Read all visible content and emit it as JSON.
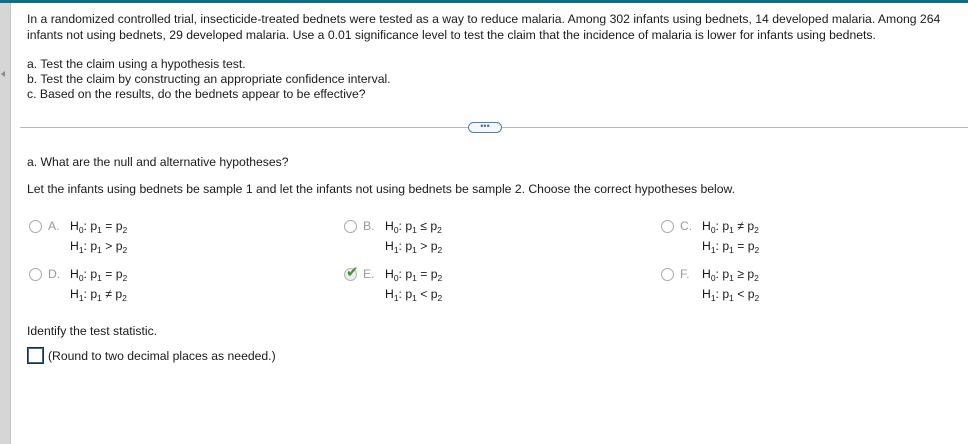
{
  "problem": {
    "text": "In a randomized controlled trial, insecticide-treated bednets were tested as a way to reduce malaria. Among 302 infants using bednets, 14 developed malaria. Among 264 infants not using bednets, 29 developed malaria. Use a 0.01 significance level to test the claim that the incidence of malaria is lower for infants using bednets.",
    "parts": [
      "a. Test the claim using a hypothesis test.",
      "b. Test the claim by constructing an appropriate confidence interval.",
      "c. Based on the results, do the bednets appear to be effective?"
    ]
  },
  "expand_button": "•••",
  "question_a": "a. What are the null and alternative hypotheses?",
  "lead_text": "Let the infants using bednets be sample 1 and let the infants not using bednets be sample 2. Choose the correct hypotheses below.",
  "options": {
    "A": {
      "letter": "A.",
      "h0_rel": "=",
      "h1_rel": ">",
      "selected": false
    },
    "B": {
      "letter": "B.",
      "h0_rel": "≤",
      "h1_rel": ">",
      "selected": false
    },
    "C": {
      "letter": "C.",
      "h0_rel": "≠",
      "h1_rel": "=",
      "selected": false
    },
    "D": {
      "letter": "D.",
      "h0_rel": "=",
      "h1_rel": "≠",
      "selected": false
    },
    "E": {
      "letter": "E.",
      "h0_rel": "=",
      "h1_rel": "<",
      "selected": true
    },
    "F": {
      "letter": "F.",
      "h0_rel": "≥",
      "h1_rel": "<",
      "selected": false
    }
  },
  "hyp_labels": {
    "h": "H",
    "h0_sub": "0",
    "h1_sub": "1",
    "p": "p",
    "p1_sub": "1",
    "p2_sub": "2"
  },
  "identify_text": "Identify the test statistic.",
  "answer_input": {
    "value": "",
    "hint": "(Round to two decimal places as needed.)"
  },
  "colors": {
    "accent": "#0e6e8f",
    "check": "#3d9a2d",
    "divider": "#b9b9b9"
  }
}
